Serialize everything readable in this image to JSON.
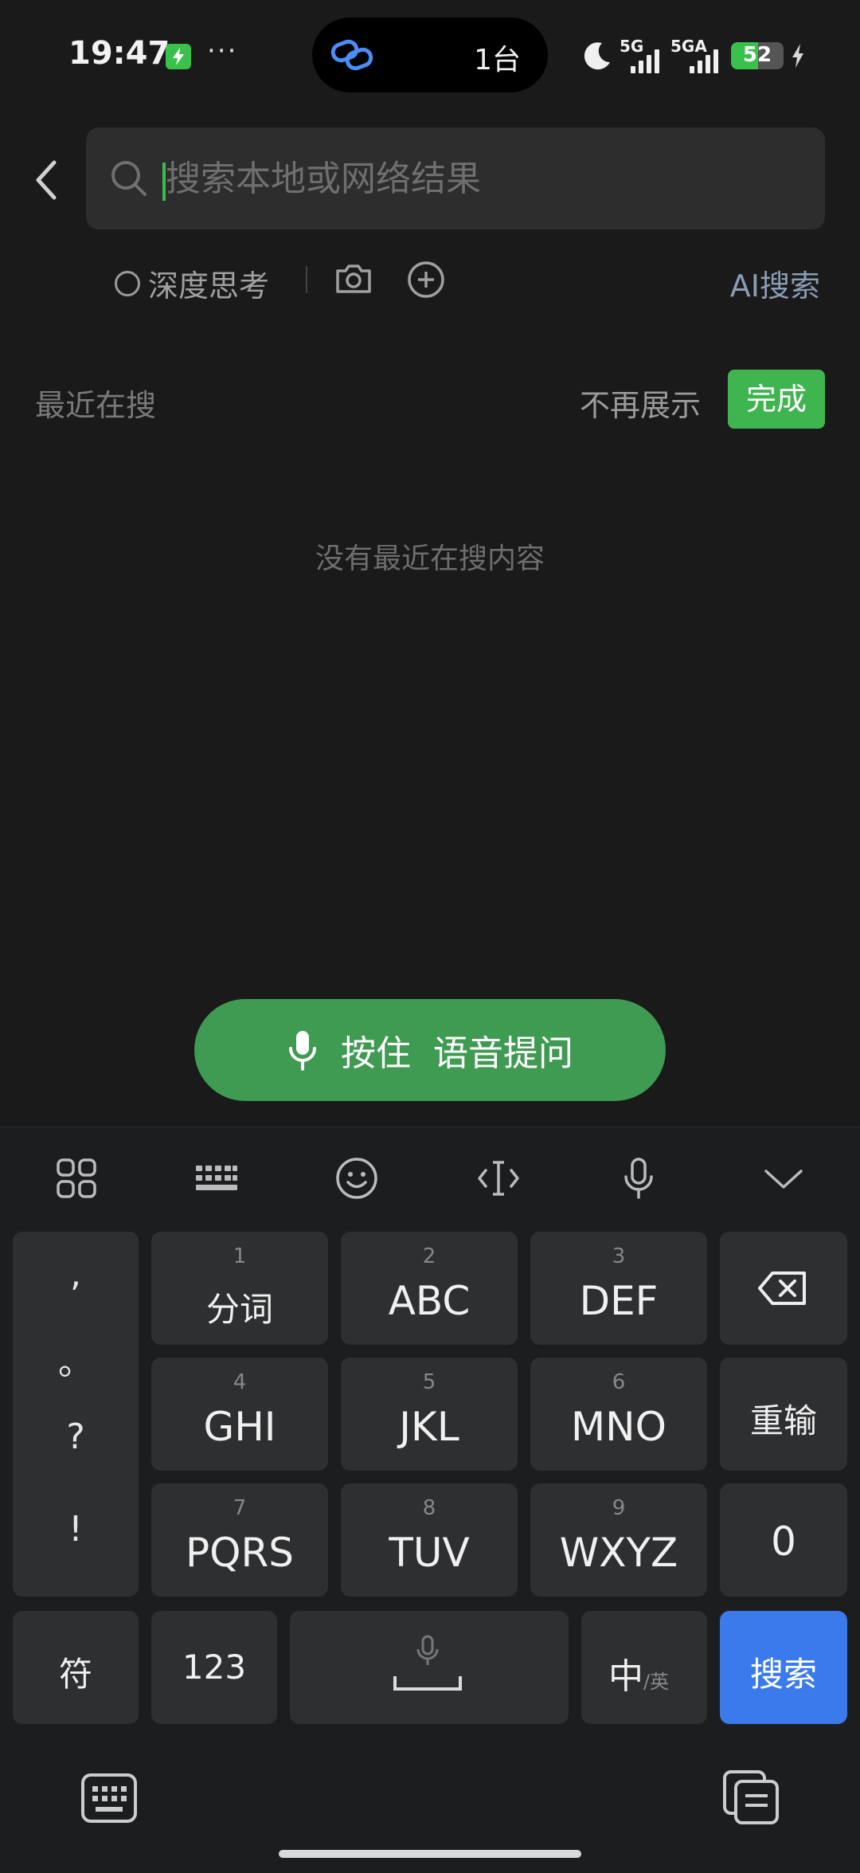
{
  "status_bar": {
    "time": "19:47",
    "overflow": "···",
    "island_text": "1台",
    "signal1_label": "5G",
    "signal2_label": "5GA",
    "battery_level": "52",
    "battery_fraction": 0.52,
    "accent_color": "#3ac14b"
  },
  "search": {
    "placeholder": "搜索本地或网络结果",
    "value": ""
  },
  "tools": {
    "deep_think": "深度思考",
    "ai_search": "AI搜索"
  },
  "recent": {
    "title": "最近在搜",
    "hide_label": "不再展示",
    "done_label": "完成",
    "empty_text": "没有最近在搜内容"
  },
  "voice": {
    "label": "按住  语音提问",
    "color": "#3f9a52"
  },
  "keyboard": {
    "punctuation": [
      ",",
      "。",
      "?",
      "!"
    ],
    "rows": [
      [
        {
          "num": "1",
          "label": "分词"
        },
        {
          "num": "2",
          "label": "ABC"
        },
        {
          "num": "3",
          "label": "DEF"
        }
      ],
      [
        {
          "num": "4",
          "label": "GHI"
        },
        {
          "num": "5",
          "label": "JKL"
        },
        {
          "num": "6",
          "label": "MNO"
        }
      ],
      [
        {
          "num": "7",
          "label": "PQRS"
        },
        {
          "num": "8",
          "label": "TUV"
        },
        {
          "num": "9",
          "label": "WXYZ"
        }
      ]
    ],
    "reinput": "重输",
    "zero": "0",
    "symbols": "符",
    "numbers": "123",
    "lang_main": "中",
    "lang_sub": "/英",
    "search_key": "搜索",
    "search_color": "#3b7aeb"
  }
}
